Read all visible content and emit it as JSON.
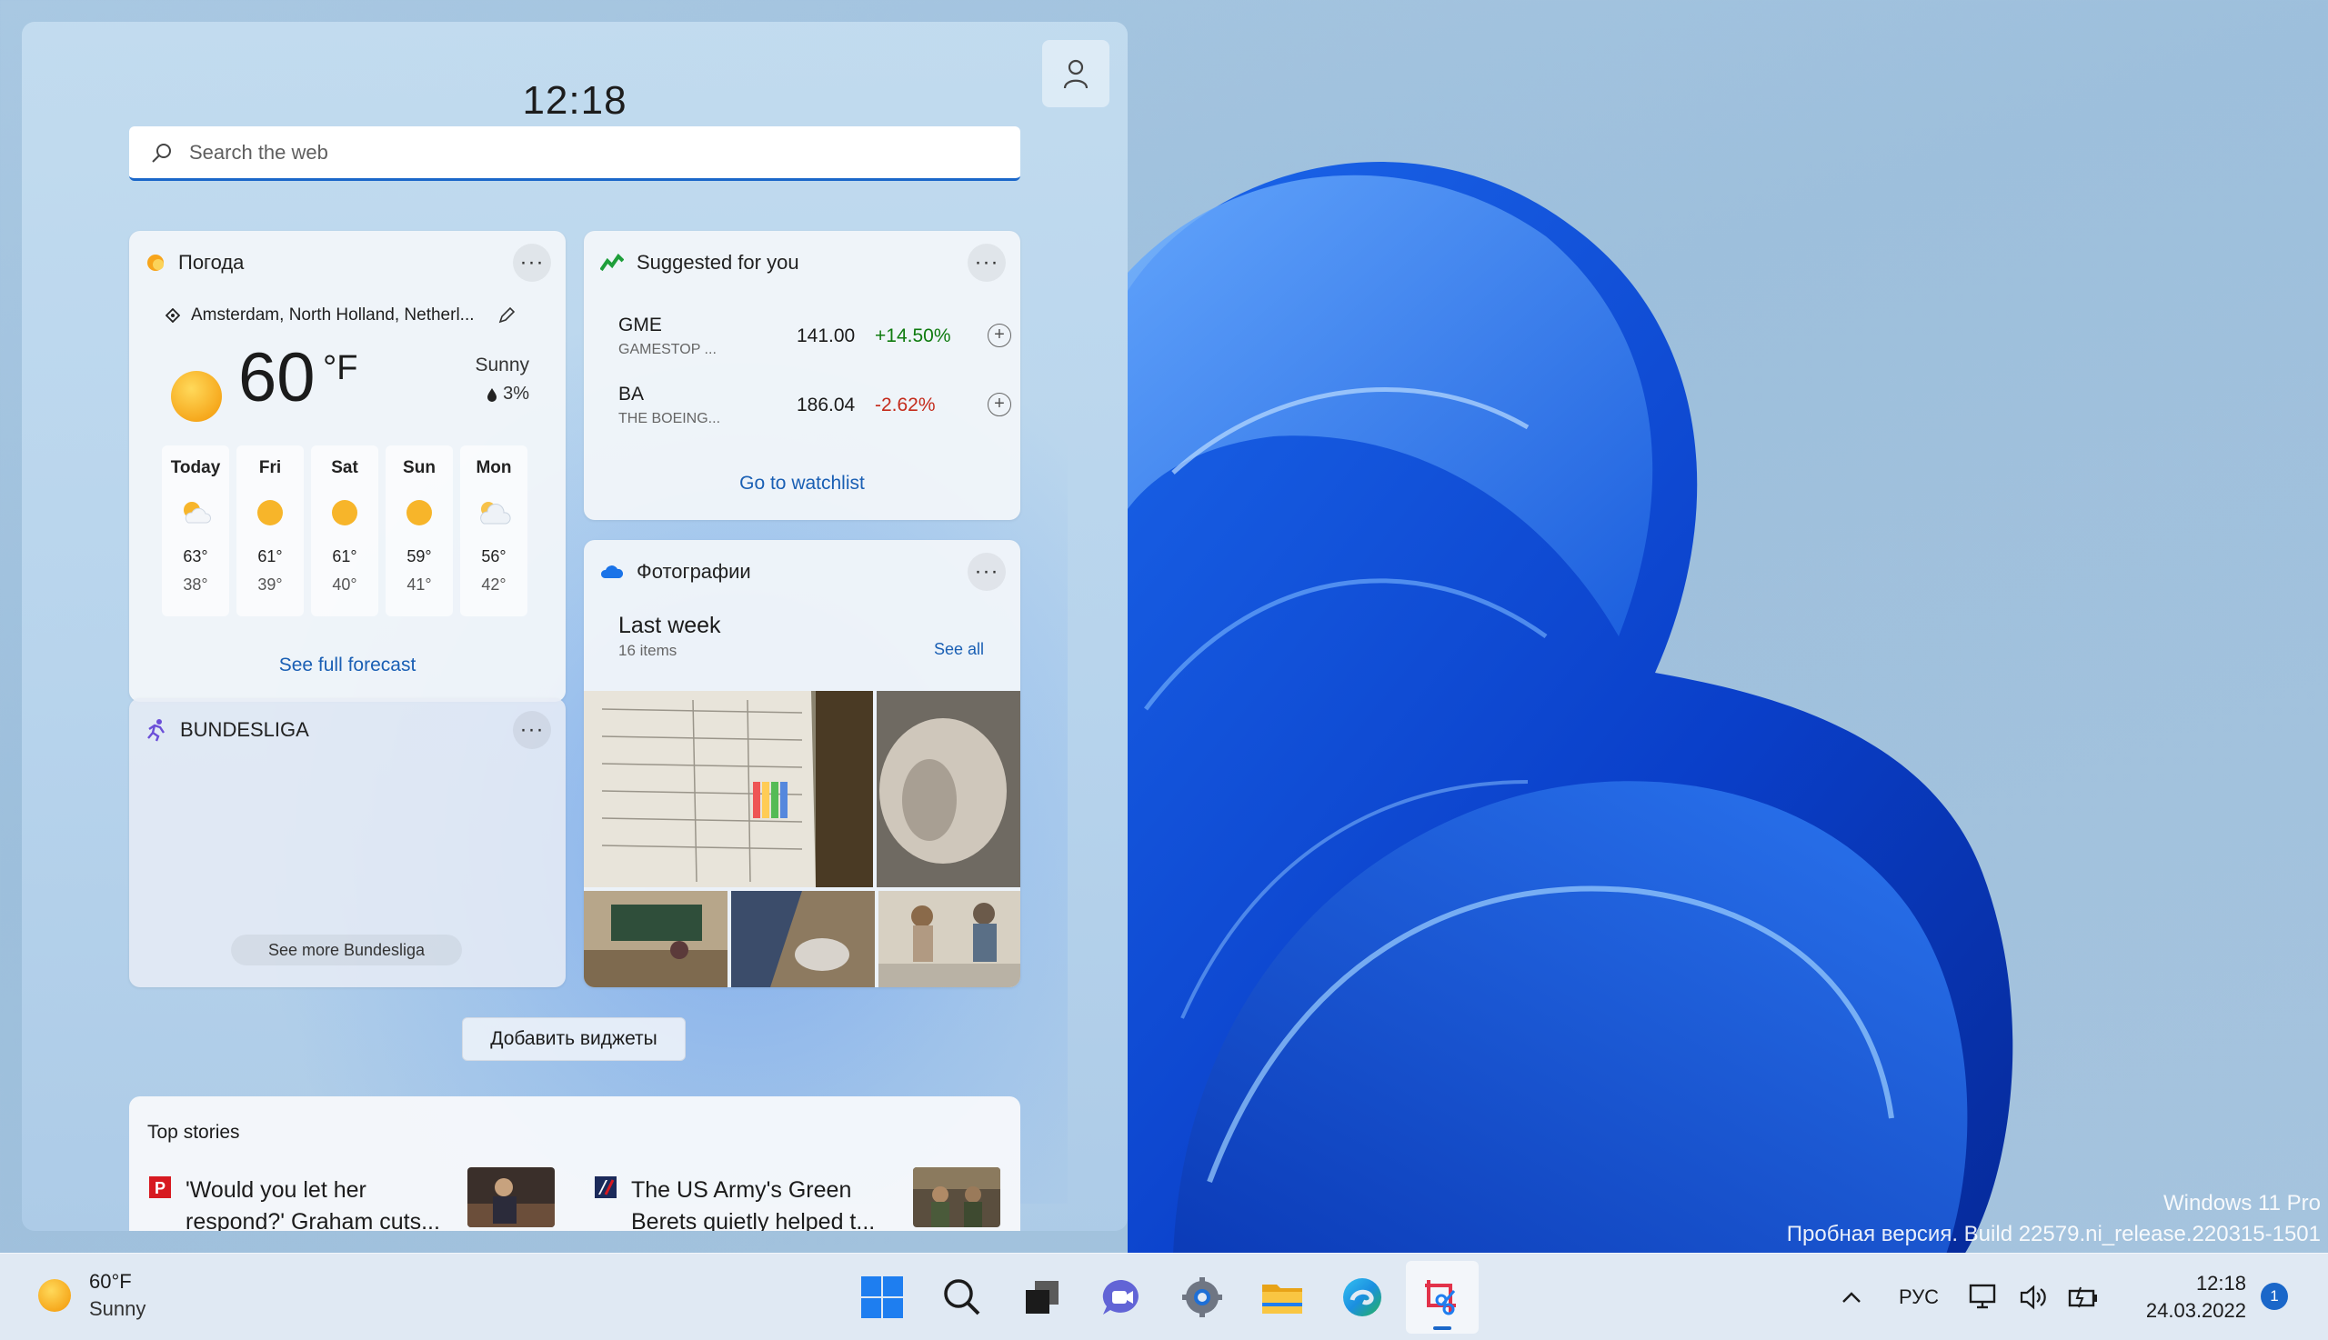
{
  "panel": {
    "time": "12:18",
    "search_placeholder": "Search the web"
  },
  "weather": {
    "title": "Погода",
    "location": "Amsterdam, North Holland, Netherl...",
    "temp": "60",
    "unit": "°F",
    "condition": "Sunny",
    "precip": "3%",
    "days": [
      {
        "name": "Today",
        "icon": "partly-sunny-icon",
        "hi": "63°",
        "lo": "38°"
      },
      {
        "name": "Fri",
        "icon": "sun-icon",
        "hi": "61°",
        "lo": "39°"
      },
      {
        "name": "Sat",
        "icon": "sun-icon",
        "hi": "61°",
        "lo": "40°"
      },
      {
        "name": "Sun",
        "icon": "sun-icon",
        "hi": "59°",
        "lo": "41°"
      },
      {
        "name": "Mon",
        "icon": "cloudy-icon",
        "hi": "56°",
        "lo": "42°"
      }
    ],
    "forecast_link": "See full forecast"
  },
  "stocks": {
    "title": "Suggested for you",
    "items": [
      {
        "symbol": "GME",
        "name": "GAMESTOP ...",
        "price": "141.00",
        "change": "+14.50%",
        "color": "#0f7b0f"
      },
      {
        "symbol": "BA",
        "name": "THE BOEING...",
        "price": "186.04",
        "change": "-2.62%",
        "color": "#c42b1c"
      }
    ],
    "watchlist_link": "Go to watchlist"
  },
  "photos": {
    "title": "Фотографии",
    "album": "Last week",
    "count": "16 items",
    "see_all": "See all"
  },
  "bundesliga": {
    "title": "BUNDESLIGA",
    "more": "See more Bundesliga"
  },
  "add_widgets": "Добавить виджеты",
  "stories": {
    "header": "Top stories",
    "items": [
      {
        "text": "'Would you let her respond?' Graham cuts..."
      },
      {
        "text": "The US Army's Green Berets quietly helped t..."
      }
    ]
  },
  "watermark": {
    "line1": "Windows 11 Pro",
    "line2": "Пробная версия. Build 22579.ni_release.220315-1501"
  },
  "taskbar": {
    "weather_temp": "60°F",
    "weather_cond": "Sunny",
    "language": "РУС",
    "time": "12:18",
    "date": "24.03.2022",
    "notifications": "1",
    "accent": "#1a67c9"
  }
}
